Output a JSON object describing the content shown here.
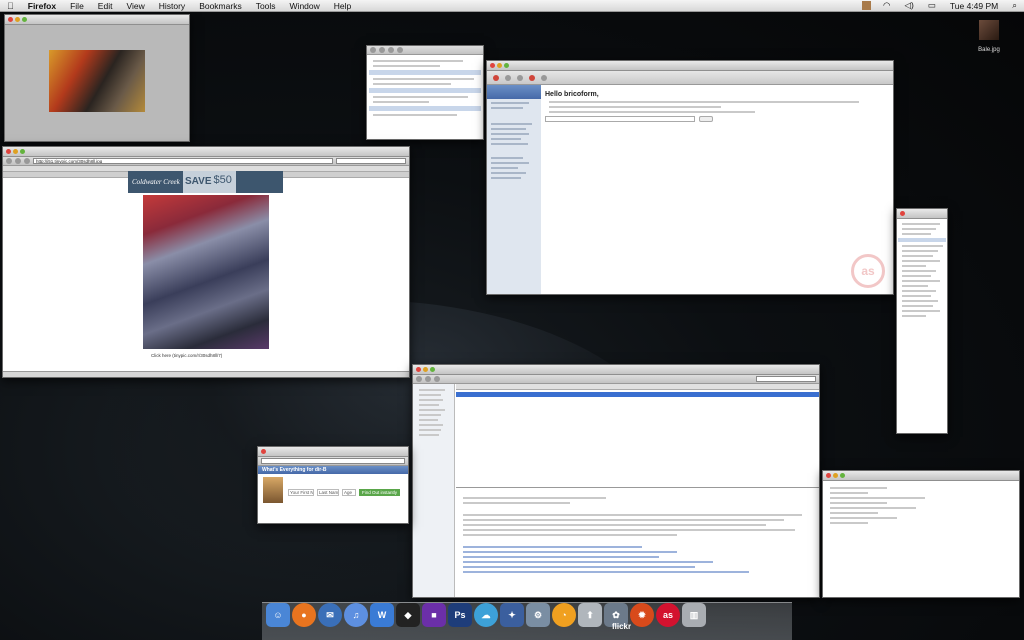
{
  "menubar": {
    "app_name": "Firefox",
    "menus": [
      "File",
      "Edit",
      "View",
      "History",
      "Bookmarks",
      "Tools",
      "Window",
      "Help"
    ],
    "clock": "Tue 4:49 PM"
  },
  "desktop": {
    "file_label": "Bale.jpg"
  },
  "firefox_window": {
    "url": "http://i51.tinypic.com/30sdh8ll.jpg",
    "banner_brand": "Coldwater Creek",
    "banner_save": "SAVE",
    "banner_amount": "$50",
    "caption": "Click here (tinypic.com/r/30sdh8ll/7)"
  },
  "twitter_dialog": {
    "header": "What's Everything for dir-B",
    "fields": [
      "Your First Name",
      "Last Name",
      "Age"
    ],
    "button": "Find Out instantly"
  },
  "itunes_window": {
    "greeting": "Hello bricoform,"
  },
  "dock": {
    "apps": [
      {
        "icon": "finder-icon",
        "color": "#4a86d6",
        "glyph": "☺"
      },
      {
        "icon": "firefox-icon",
        "color": "#e8741f",
        "glyph": "●"
      },
      {
        "icon": "thunderbird-icon",
        "color": "#3a6fb8",
        "glyph": "✉"
      },
      {
        "icon": "itunes-icon",
        "color": "#5d8fe0",
        "glyph": "♫"
      },
      {
        "icon": "word-icon",
        "color": "#3a7bd5",
        "glyph": "W"
      },
      {
        "icon": "adium-icon",
        "color": "#222222",
        "glyph": "◆"
      },
      {
        "icon": "dashboard-icon",
        "color": "#6b2fa8",
        "glyph": "■"
      },
      {
        "icon": "photoshop-icon",
        "color": "#1e3d7a",
        "glyph": "Ps"
      },
      {
        "icon": "tweetdeck-icon",
        "color": "#3da1d8",
        "glyph": "☁"
      },
      {
        "icon": "imovie-icon",
        "color": "#3b5f9e",
        "glyph": "✦"
      },
      {
        "icon": "system-icon",
        "color": "#7a8ea3",
        "glyph": "⚙"
      },
      {
        "icon": "growl-icon",
        "color": "#f0a020",
        "glyph": "◔"
      },
      {
        "icon": "upload-icon",
        "color": "#b0b6bc",
        "glyph": "⬆"
      },
      {
        "icon": "iphoto-icon",
        "color": "#6c7a8a",
        "glyph": "✿"
      },
      {
        "icon": "burn-icon",
        "color": "#d84a1b",
        "glyph": "✹"
      },
      {
        "icon": "lastfm-icon",
        "color": "#d3122f",
        "glyph": "as"
      },
      {
        "icon": "trash-icon",
        "color": "#a9adb2",
        "glyph": "▥"
      }
    ],
    "flickr_label": "flickr"
  }
}
